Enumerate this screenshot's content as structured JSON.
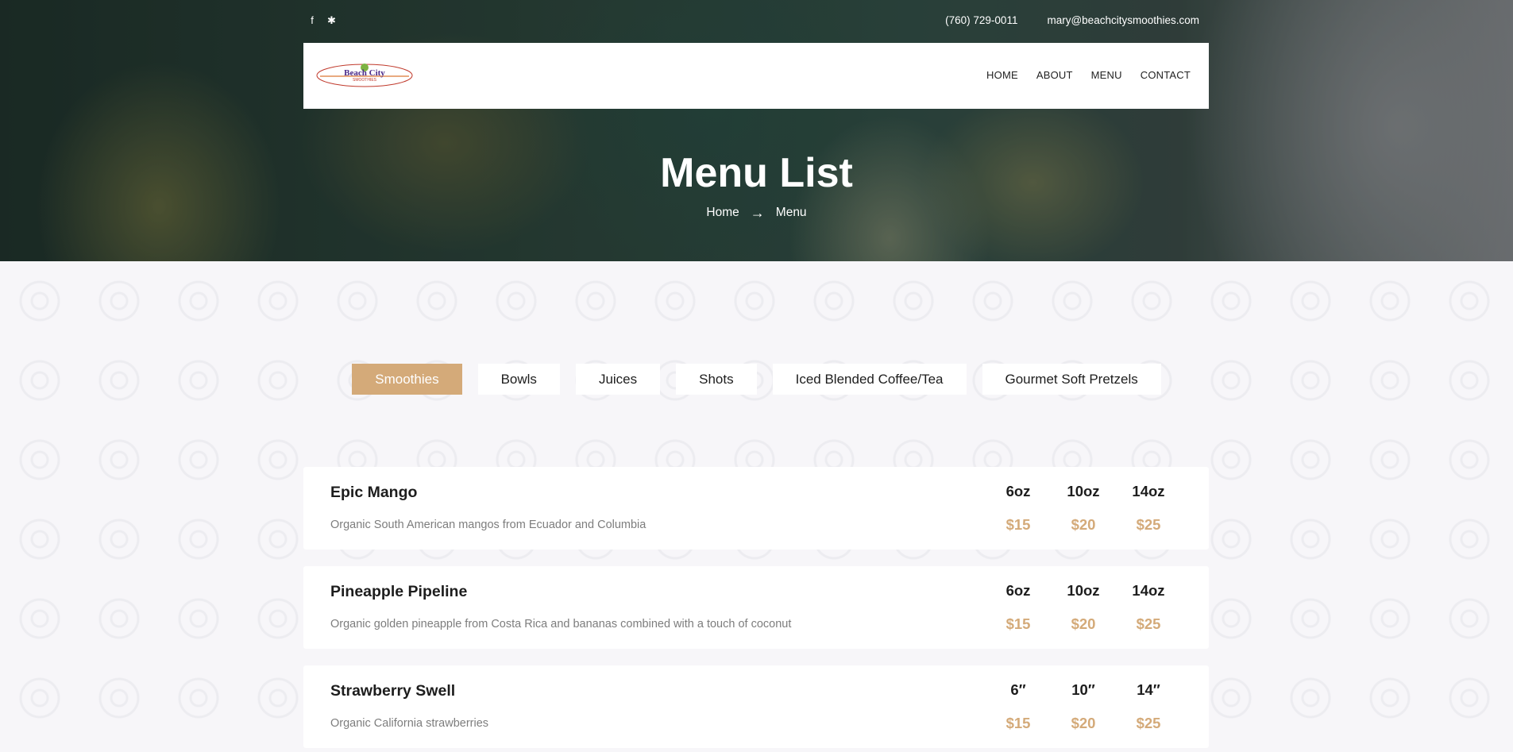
{
  "topbar": {
    "social_icons": [
      "facebook-icon",
      "yelp-icon"
    ],
    "phone": "(760) 729-0011",
    "email": "mary@beachcitysmoothies.com"
  },
  "logo": {
    "line1": "Beach City",
    "line2": "SMOOTHIES"
  },
  "nav": {
    "items": [
      "HOME",
      "ABOUT",
      "MENU",
      "CONTACT"
    ]
  },
  "hero": {
    "title": "Menu List",
    "breadcrumb": [
      "Home",
      "Menu"
    ]
  },
  "tabs": [
    {
      "label": "Smoothies",
      "active": true
    },
    {
      "label": "Bowls",
      "active": false
    },
    {
      "label": "Juices",
      "active": false
    },
    {
      "label": "Shots",
      "active": false
    },
    {
      "label": "Iced Blended Coffee/Tea",
      "active": false
    },
    {
      "label": "Gourmet Soft Pretzels",
      "active": false
    }
  ],
  "menu_items": [
    {
      "name": "Epic Mango",
      "description": "Organic South American mangos from Ecuador and Columbia",
      "sizes": [
        "6oz",
        "10oz",
        "14oz"
      ],
      "prices": [
        "$15",
        "$20",
        "$25"
      ]
    },
    {
      "name": "Pineapple Pipeline",
      "description": "Organic golden pineapple from Costa Rica and bananas combined with a touch of coconut",
      "sizes": [
        "6oz",
        "10oz",
        "14oz"
      ],
      "prices": [
        "$15",
        "$20",
        "$25"
      ]
    },
    {
      "name": "Strawberry Swell",
      "description": "Organic California strawberries",
      "sizes": [
        "6″",
        "10″",
        "14″"
      ],
      "prices": [
        "$15",
        "$20",
        "$25"
      ]
    }
  ],
  "colors": {
    "accent": "#d4aa79",
    "text_dark": "#1d1d1d",
    "text_muted": "#7d7d7d"
  }
}
